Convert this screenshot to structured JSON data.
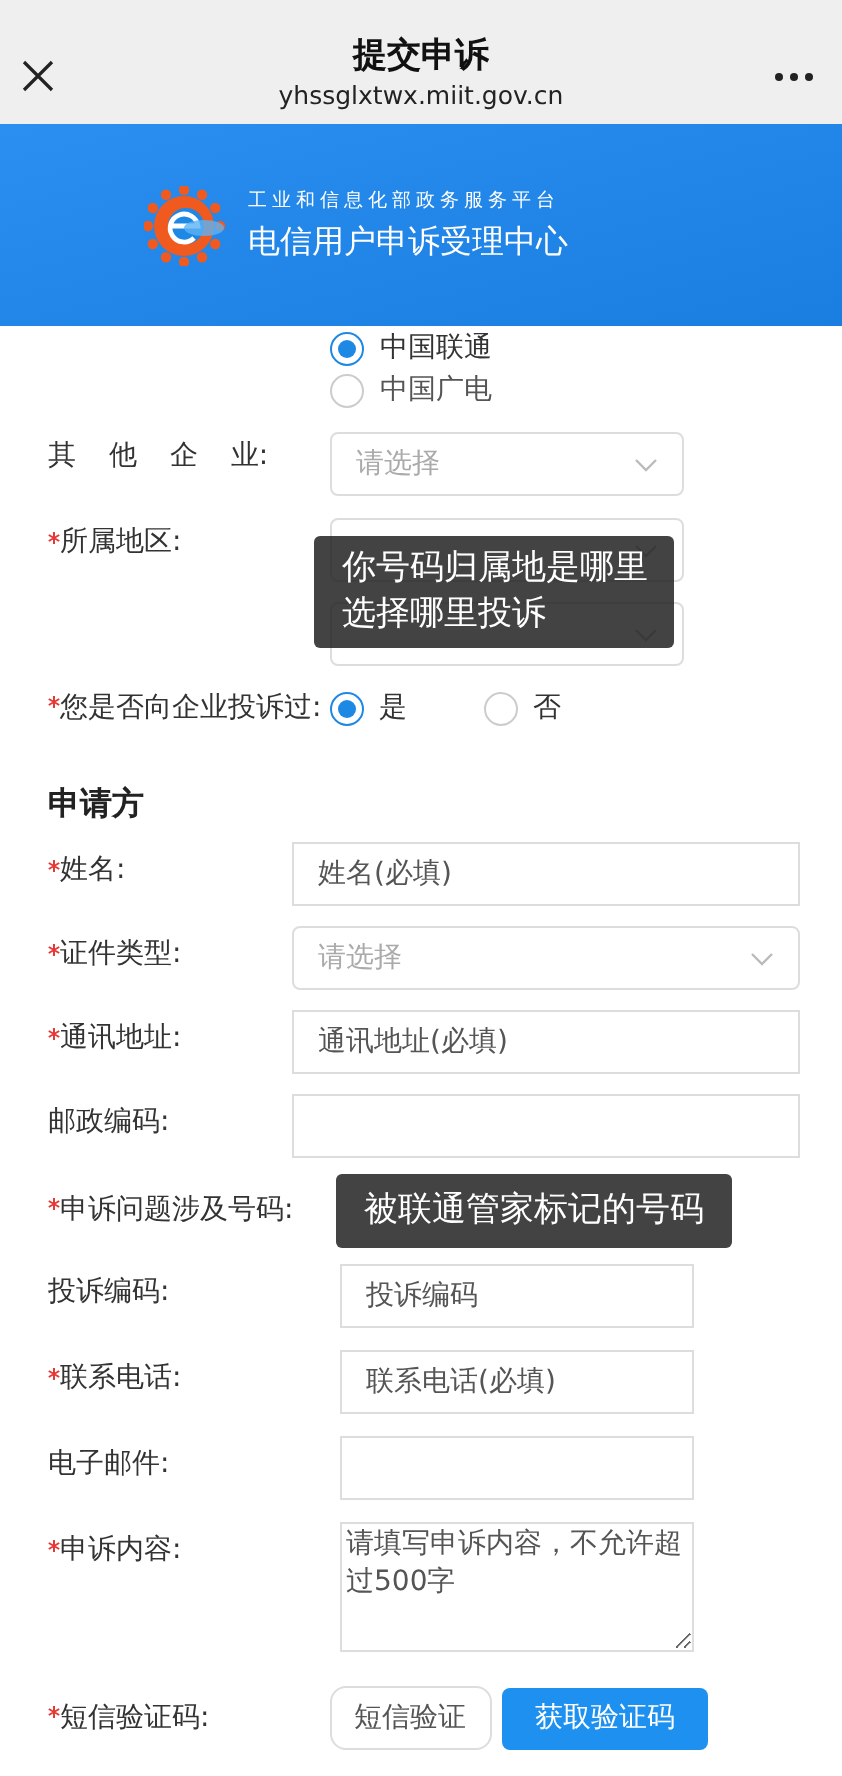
{
  "header": {
    "title": "提交申诉",
    "url": "yhssglxtwx.miit.gov.cn"
  },
  "banner": {
    "subtitle": "工业和信息化部政务服务平台",
    "title": "电信用户申诉受理中心"
  },
  "carrier_options": [
    {
      "label": "中国联通",
      "selected": true
    },
    {
      "label": "中国广电",
      "selected": false
    }
  ],
  "other_enterprise": {
    "label": "其 他 企 业:",
    "placeholder": "请选择"
  },
  "region": {
    "label": "所属地区:",
    "required": true,
    "tooltip": [
      "你号码归属地是哪里",
      "选择哪里投诉"
    ]
  },
  "complained_before": {
    "label": "您是否向企业投诉过:",
    "required": true,
    "options": [
      {
        "label": "是",
        "selected": true
      },
      {
        "label": "否",
        "selected": false
      }
    ]
  },
  "section_title": "申请方",
  "applicant_fields": [
    {
      "label": "姓名:",
      "required": true,
      "kind": "input",
      "placeholder": "姓名(必填)"
    },
    {
      "label": "证件类型:",
      "required": true,
      "kind": "select",
      "placeholder": "请选择"
    },
    {
      "label": "通讯地址:",
      "required": true,
      "kind": "input",
      "placeholder": "通讯地址(必填)"
    },
    {
      "label": "邮政编码:",
      "required": false,
      "kind": "input"
    }
  ],
  "complaint_number": {
    "label": "申诉问题涉及号码:",
    "required": true,
    "tooltip": "被联通管家标记的号码"
  },
  "complaint_fields": [
    {
      "label": "投诉编码:",
      "required": false,
      "kind": "input",
      "placeholder": "投诉编码"
    },
    {
      "label": "联系电话:",
      "required": true,
      "kind": "input",
      "placeholder": "联系电话(必填)"
    },
    {
      "label": "电子邮件:",
      "required": false,
      "kind": "input"
    },
    {
      "label": "申诉内容:",
      "required": true,
      "kind": "textarea",
      "placeholder": "请填写申诉内容，不允许超过500字"
    }
  ],
  "sms": {
    "label": "短信验证码:",
    "required": true,
    "placeholder": "短信验证",
    "button": "获取验证码"
  }
}
